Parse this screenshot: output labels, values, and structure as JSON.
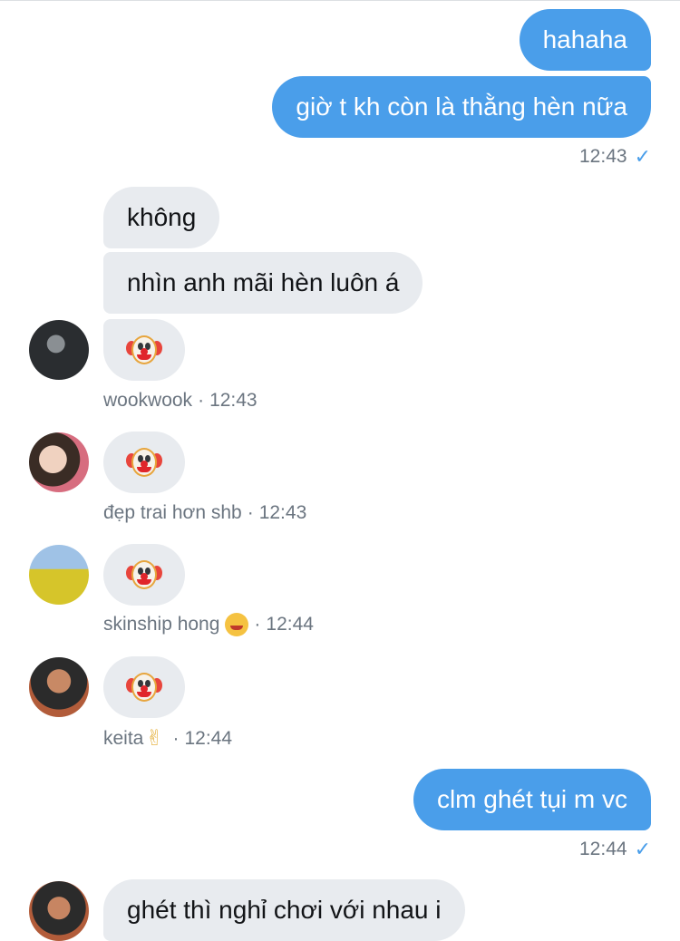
{
  "messages": {
    "out1": "hahaha",
    "out2": "giờ t kh còn là thằng hèn nữa",
    "out_time1": "12:43",
    "in1": "không",
    "in2": "nhìn anh mãi hèn luôn á",
    "sender1": "wookwook",
    "time1": "12:43",
    "sender2": "đẹp trai hơn shb",
    "time2": "12:43",
    "sender3": "skinship hong",
    "time3": "12:44",
    "sender4": "keita",
    "time4": "12:44",
    "out3": "clm ghét tụi m vc",
    "out_time2": "12:44",
    "in3_partial": "ghét thì nghỉ chơi với nhau i"
  },
  "icons": {
    "read_check": "✓",
    "separator": "·",
    "reaction_emoji": "clown-face",
    "sender3_emoji": "smiling-face-with-hearts",
    "sender4_emoji": "victory-hand"
  },
  "colors": {
    "outgoing_bubble": "#4a9eea",
    "incoming_bubble": "#e8ebef",
    "meta_text": "#6b7580"
  }
}
